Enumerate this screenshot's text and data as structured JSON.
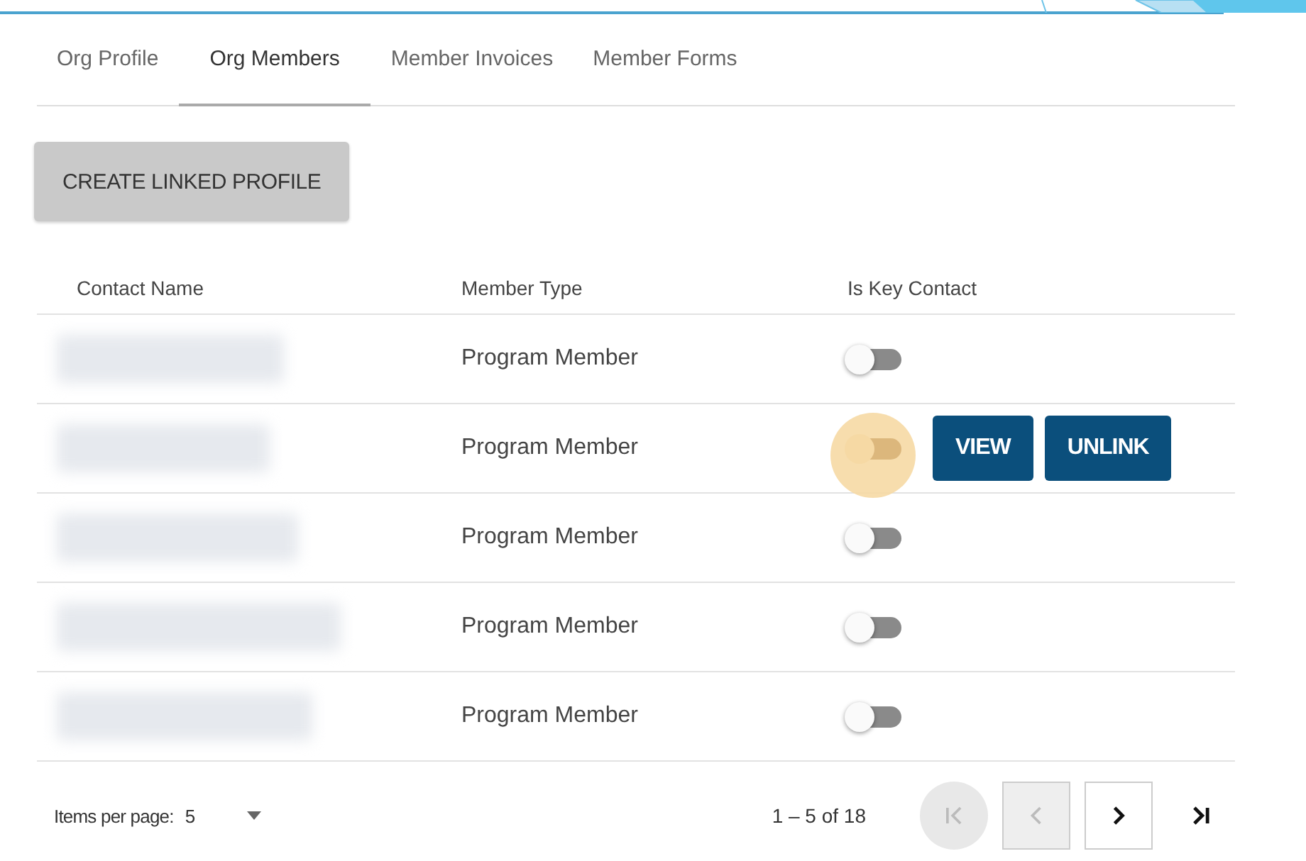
{
  "tabs": [
    {
      "label": "Org Profile",
      "selected": false
    },
    {
      "label": "Org Members",
      "selected": true
    },
    {
      "label": "Member Invoices",
      "selected": false
    },
    {
      "label": "Member Forms",
      "selected": false
    }
  ],
  "create_button": "CREATE LINKED PROFILE",
  "table": {
    "columns": [
      "Contact Name",
      "Member Type",
      "Is Key Contact"
    ],
    "rows": [
      {
        "member_type": "Program Member",
        "key_contact": false,
        "focused": false
      },
      {
        "member_type": "Program Member",
        "key_contact": false,
        "focused": true,
        "actions": [
          "VIEW",
          "UNLINK"
        ]
      },
      {
        "member_type": "Program Member",
        "key_contact": false,
        "focused": false
      },
      {
        "member_type": "Program Member",
        "key_contact": false,
        "focused": false
      },
      {
        "member_type": "Program Member",
        "key_contact": false,
        "focused": false
      }
    ]
  },
  "pager": {
    "label": "Items per page:",
    "page_size": "5",
    "range": "1 – 5 of 18",
    "buttons": [
      {
        "kind": "first",
        "disabled": true,
        "hovered": true
      },
      {
        "kind": "prev",
        "disabled": true,
        "hovered": false
      },
      {
        "kind": "next",
        "disabled": false,
        "hovered": false
      },
      {
        "kind": "last",
        "disabled": false,
        "hovered": false
      }
    ]
  }
}
